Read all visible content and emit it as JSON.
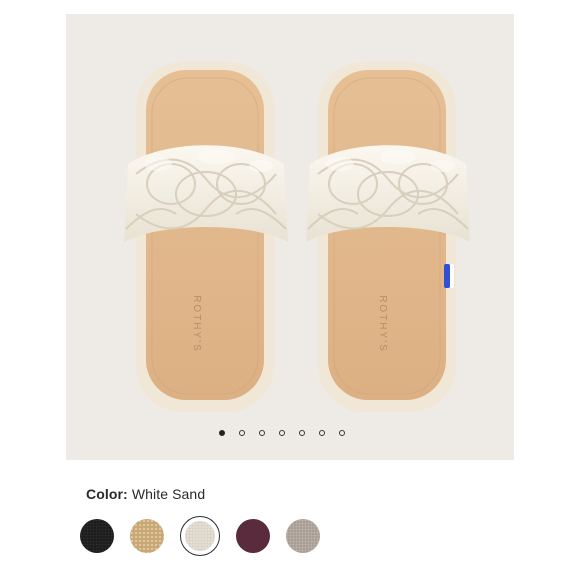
{
  "product": {
    "brand_insole_text": "ROTHY'S",
    "color_label": "Color:",
    "color_value": "White Sand"
  },
  "gallery": {
    "image_count": 7,
    "active_index": 0
  },
  "swatches": [
    {
      "name": "black-swatch",
      "color": "#1c1c1c",
      "selected": false
    },
    {
      "name": "natural-swatch",
      "color": "#c9a878",
      "selected": false
    },
    {
      "name": "white-sand-swatch",
      "color": "#e4dfd3",
      "selected": true
    },
    {
      "name": "plum-swatch",
      "color": "#5a2a3d",
      "selected": false
    },
    {
      "name": "grey-swatch",
      "color": "#a89e95",
      "selected": false
    }
  ],
  "colors": {
    "gallery_bg": "#eeeae5",
    "sole_tan": "#e2b88c",
    "strap_cream": "#f4efe4",
    "platform": "#f0e6d6"
  }
}
